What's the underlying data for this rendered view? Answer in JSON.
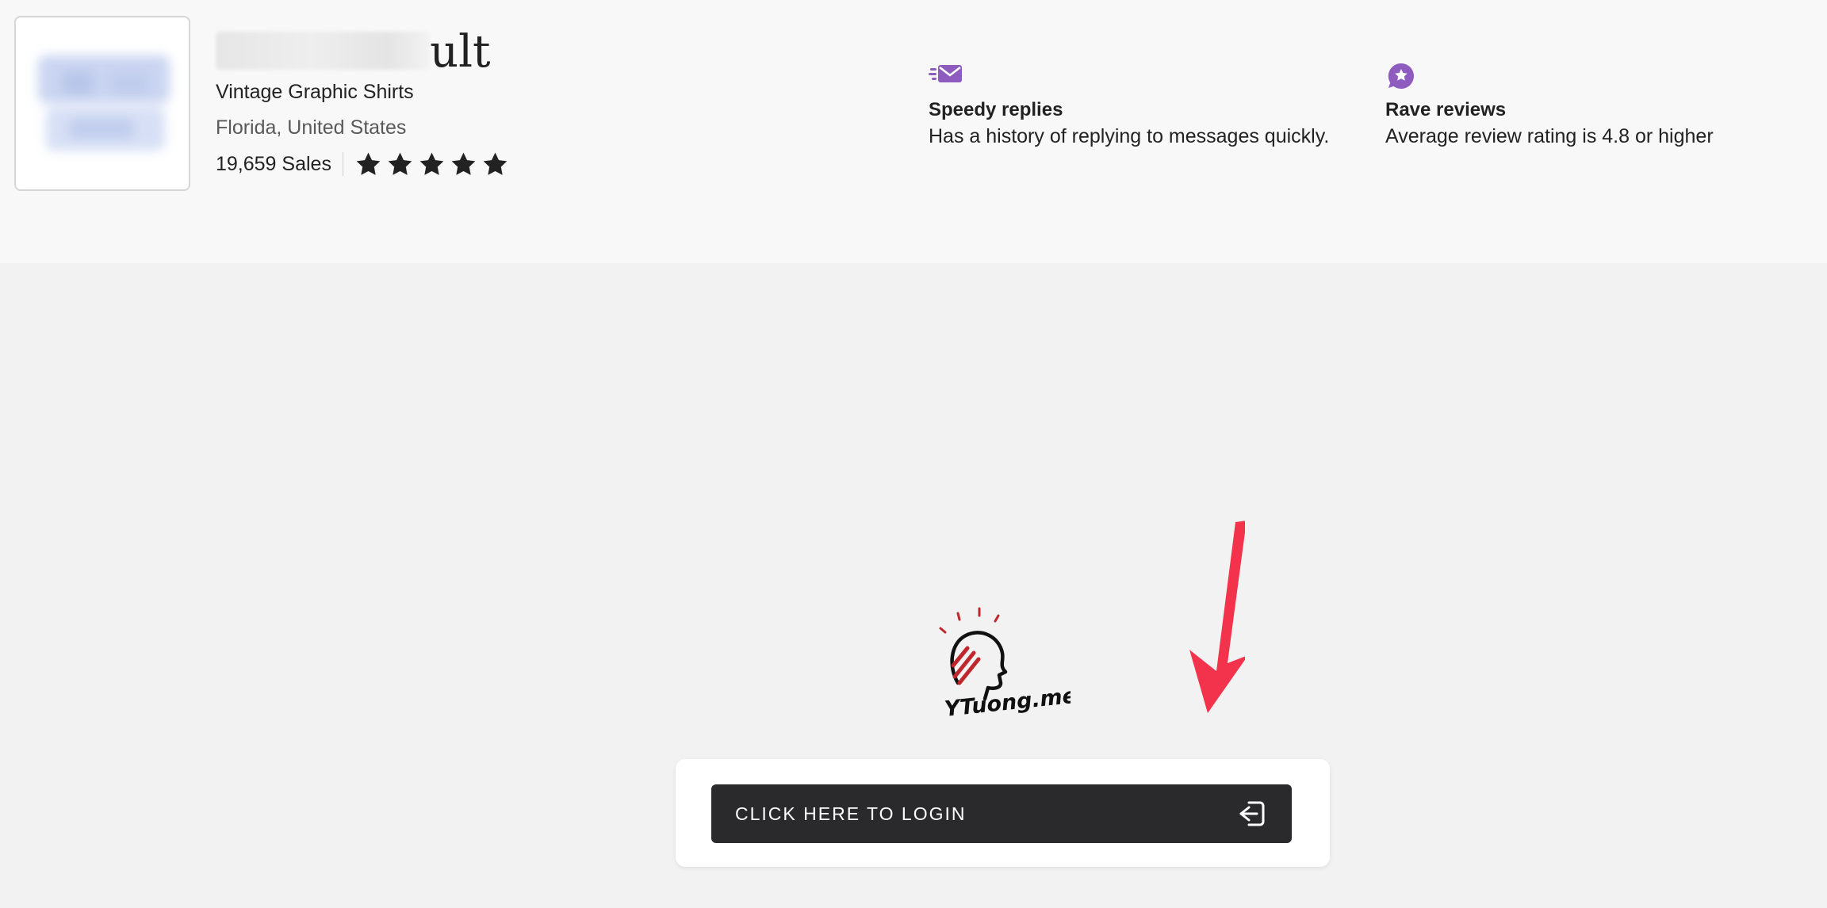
{
  "shop": {
    "name_visible": "ult",
    "name_masked": "oldschoolc",
    "title": "Vintage Graphic Shirts",
    "location": "Florida, United States",
    "sales": "19,659 Sales",
    "rating_stars": 5,
    "logo_icon": "shop-logo-image-blurred"
  },
  "badges": [
    {
      "icon": "mail-fast-icon",
      "title": "Speedy replies",
      "description": "Has a history of replying to messages quickly."
    },
    {
      "icon": "star-chat-icon",
      "title": "Rave reviews",
      "description": "Average review rating is 4.8 or higher"
    }
  ],
  "watermark": {
    "text": "YTuong.me"
  },
  "login": {
    "button_label": "CLICK HERE TO LOGIN",
    "icon": "login-enter-icon"
  },
  "colors": {
    "accent_purple": "#8e5bbf",
    "arrow_red": "#f2334b",
    "button_dark": "#2a2a2c",
    "header_bg": "#f8f8f8",
    "page_bg": "#f2f2f2"
  }
}
